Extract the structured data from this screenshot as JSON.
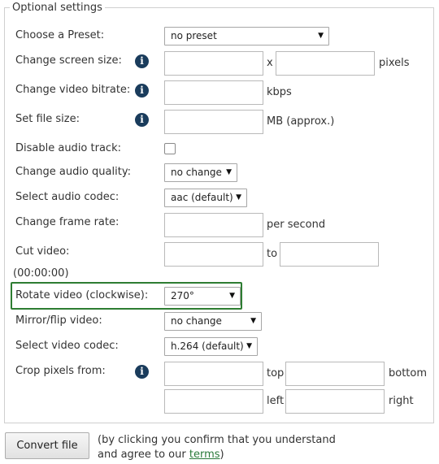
{
  "legend": "Optional settings",
  "rows": {
    "preset_label": "Choose a Preset:",
    "preset_value": "no preset",
    "screen_label": "Change screen size:",
    "screen_x": "x",
    "screen_unit": "pixels",
    "bitrate_label": "Change video bitrate:",
    "bitrate_unit": "kbps",
    "filesize_label": "Set file size:",
    "filesize_unit": "MB (approx.)",
    "disable_audio_label": "Disable audio track:",
    "audio_quality_label": "Change audio quality:",
    "audio_quality_value": "no change",
    "audio_codec_label": "Select audio codec:",
    "audio_codec_value": "aac (default)",
    "framerate_label": "Change frame rate:",
    "framerate_unit": "per second",
    "cut_label": "Cut video:",
    "cut_to": "to",
    "cut_format": "(00:00:00)",
    "rotate_label": "Rotate video (clockwise):",
    "rotate_value": "270°",
    "mirror_label": "Mirror/flip video:",
    "mirror_value": "no change",
    "video_codec_label": "Select video codec:",
    "video_codec_value": "h.264 (default)",
    "crop_label": "Crop pixels from:",
    "crop_top": "top",
    "crop_bottom": "bottom",
    "crop_left": "left",
    "crop_right": "right"
  },
  "info_glyph": "i",
  "select_arrow": "▼",
  "convert_button": "Convert file",
  "note_text": "(by clicking you confirm that you understand and agree to our ",
  "note_link": "terms",
  "note_end": ")",
  "colors": {
    "highlight": "#2e7d32",
    "info_icon": "#1a3c5c",
    "link": "#2a7a3a"
  }
}
